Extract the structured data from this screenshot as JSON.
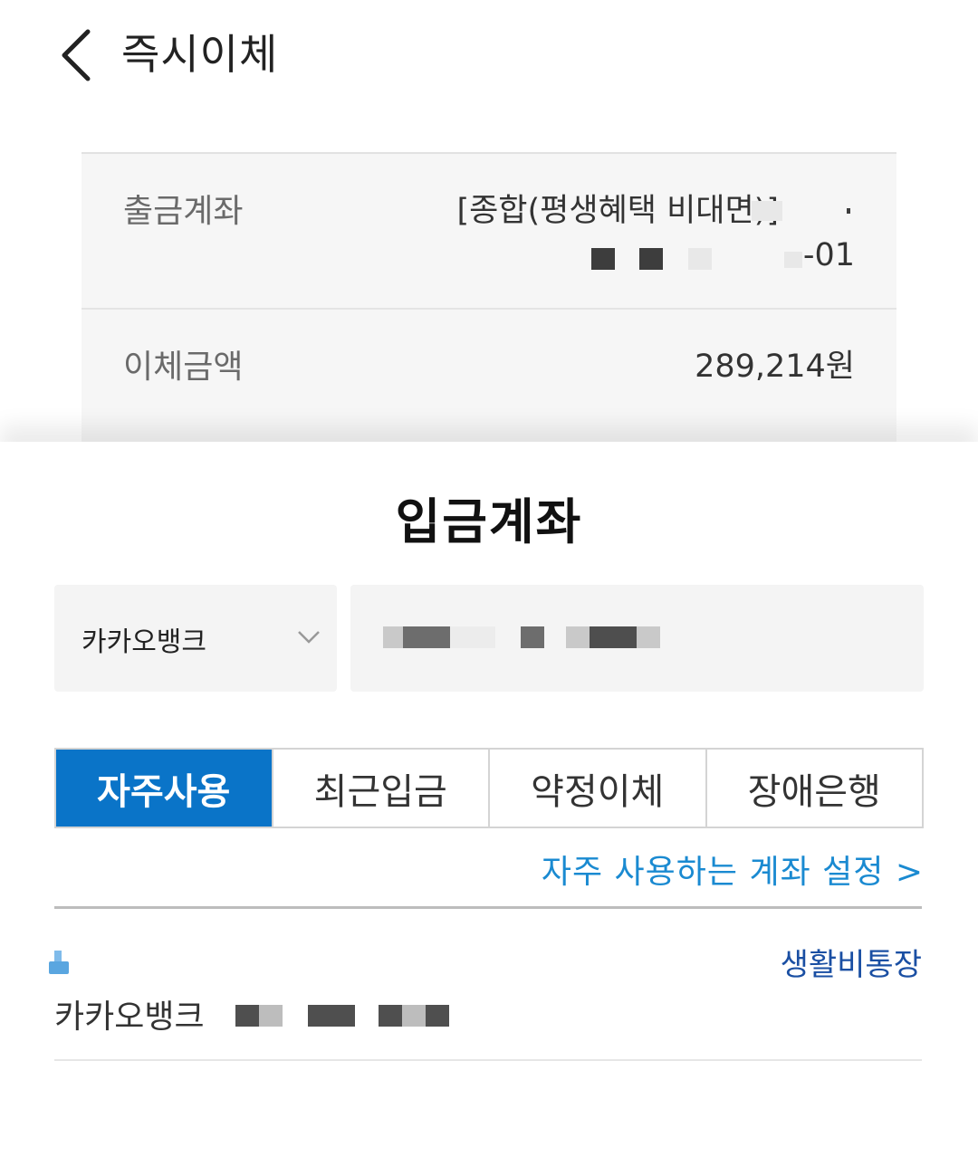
{
  "header": {
    "title": "즉시이체",
    "back_icon": "chevron-left-icon"
  },
  "summary": {
    "from_label": "출금계좌",
    "from_value_line1": "[종합(평생혜택 비대면)]",
    "from_value_suffix": "-01",
    "amount_label": "이체금액",
    "amount_value": "289,214원"
  },
  "sheet": {
    "title": "입금계좌",
    "bank_select": {
      "selected": "카카오뱅크",
      "icon": "chevron-down-icon"
    },
    "tabs": [
      {
        "label": "자주사용",
        "active": true
      },
      {
        "label": "최근입금",
        "active": false
      },
      {
        "label": "약정이체",
        "active": false
      },
      {
        "label": "장애은행",
        "active": false
      }
    ],
    "fav_link": "자주 사용하는 계좌 설정 >",
    "accounts": [
      {
        "bank": "카카오뱅크",
        "tag": "생활비통장"
      }
    ]
  },
  "colors": {
    "accent": "#0a74c8",
    "link": "#1a8ad1",
    "tag": "#1a4fa3"
  }
}
